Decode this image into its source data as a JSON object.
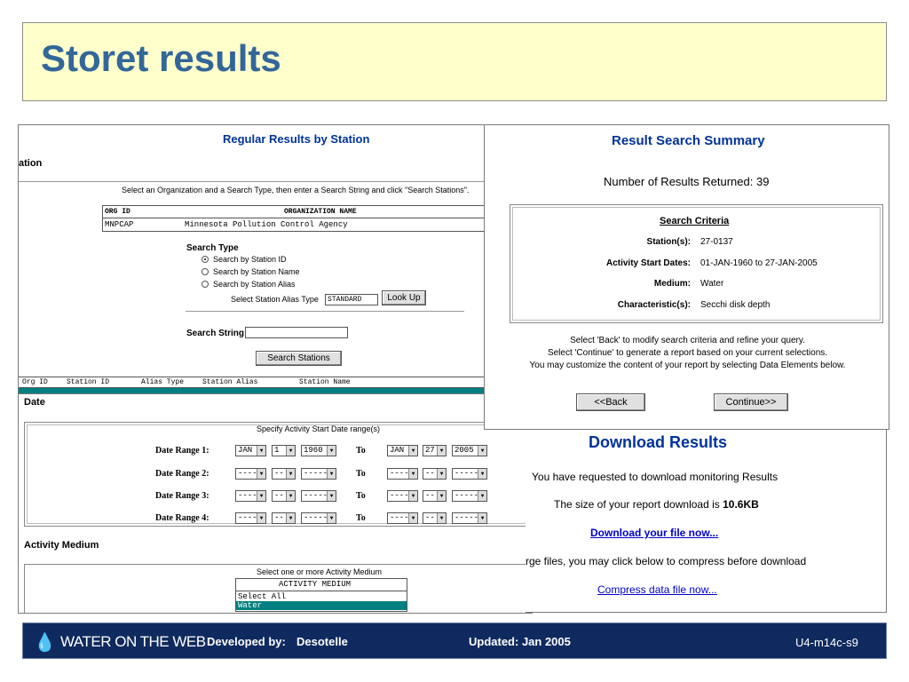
{
  "slide": {
    "title": "Storet results",
    "footer": {
      "logo_text": "WATER ON THE WEB",
      "developed_label": "Developed by:",
      "developed_value": "Desotelle",
      "updated": "Updated: Jan 2005",
      "slide_id": "U4-m14c-s9"
    }
  },
  "station_page": {
    "header": "Regular Results by Station",
    "section_label": "ation",
    "instruction": "Select an Organization and a Search Type, then enter a Search String and click \"Search Stations\".",
    "org_table": {
      "headers": [
        "ORG ID",
        "ORGANIZATION NAME"
      ],
      "row": [
        "MNPCAP",
        "Minnesota Pollution Control Agency"
      ]
    },
    "search_type_label": "Search Type",
    "search_types": [
      "Search by Station ID",
      "Search by Station Name",
      "Search by Station Alias"
    ],
    "alias_type_label": "Select Station Alias Type",
    "alias_type_value": "STANDARD",
    "lookup_button": "Look Up",
    "search_string_label": "Search String",
    "search_string_value": "",
    "search_button": "Search Stations",
    "result_headers": [
      "Org ID",
      "Station ID",
      "Alias Type",
      "Station Alias",
      "Station Name"
    ]
  },
  "date_page": {
    "section_label": "Date",
    "instruction": "Specify Activity Start Date range(s)",
    "ranges": [
      {
        "label": "Date Range 1:",
        "from": [
          "JAN",
          "1",
          "1960"
        ],
        "to_label": "To",
        "to": [
          "JAN",
          "27",
          "2005"
        ]
      },
      {
        "label": "Date Range 2:",
        "from": [
          "----",
          "--",
          "-----"
        ],
        "to_label": "To",
        "to": [
          "----",
          "--",
          "-----"
        ]
      },
      {
        "label": "Date Range 3:",
        "from": [
          "----",
          "--",
          "-----"
        ],
        "to_label": "To",
        "to": [
          "----",
          "--",
          "-----"
        ]
      },
      {
        "label": "Date Range 4:",
        "from": [
          "----",
          "--",
          "-----"
        ],
        "to_label": "To",
        "to": [
          "----",
          "--",
          "-----"
        ]
      }
    ],
    "medium_label": "Activity Medium",
    "medium_instruction": "Select one or more Activity Medium",
    "medium_header": "ACTIVITY MEDIUM",
    "medium_options": [
      "Select All",
      "Water"
    ]
  },
  "summary_page": {
    "title": "Result Search Summary",
    "count_text": "Number of Results Returned: 39",
    "criteria_title": "Search Criteria",
    "criteria": [
      {
        "label": "Station(s):",
        "value": "27-0137"
      },
      {
        "label": "Activity Start Dates:",
        "value": "01-JAN-1960 to 27-JAN-2005"
      },
      {
        "label": "Medium:",
        "value": "Water"
      },
      {
        "label": "Characteristic(s):",
        "value": "Secchi disk depth"
      }
    ],
    "help_lines": [
      "Select 'Back' to modify search criteria and refine your query.",
      "Select 'Continue' to generate a report based on your current selections.",
      "You may customize the content of your report by selecting Data Elements below."
    ],
    "back_button": "<<Back",
    "continue_button": "Continue>>"
  },
  "download_page": {
    "title": "Download Results",
    "line1": "You have requested to download monitoring Results",
    "size_text": "The size of your report download is",
    "size_value": "10.6KB",
    "download_link": "Download your file now...",
    "compress_text": "rge files, you may click below to compress before download",
    "compress_link": "Compress data file now..."
  },
  "colors": {
    "title": "#336699",
    "title_bg": "#ffffcc",
    "footer_bg": "#0f2a5e",
    "header_blue": "#003399",
    "teal": "#008080",
    "link": "#0000cc"
  }
}
